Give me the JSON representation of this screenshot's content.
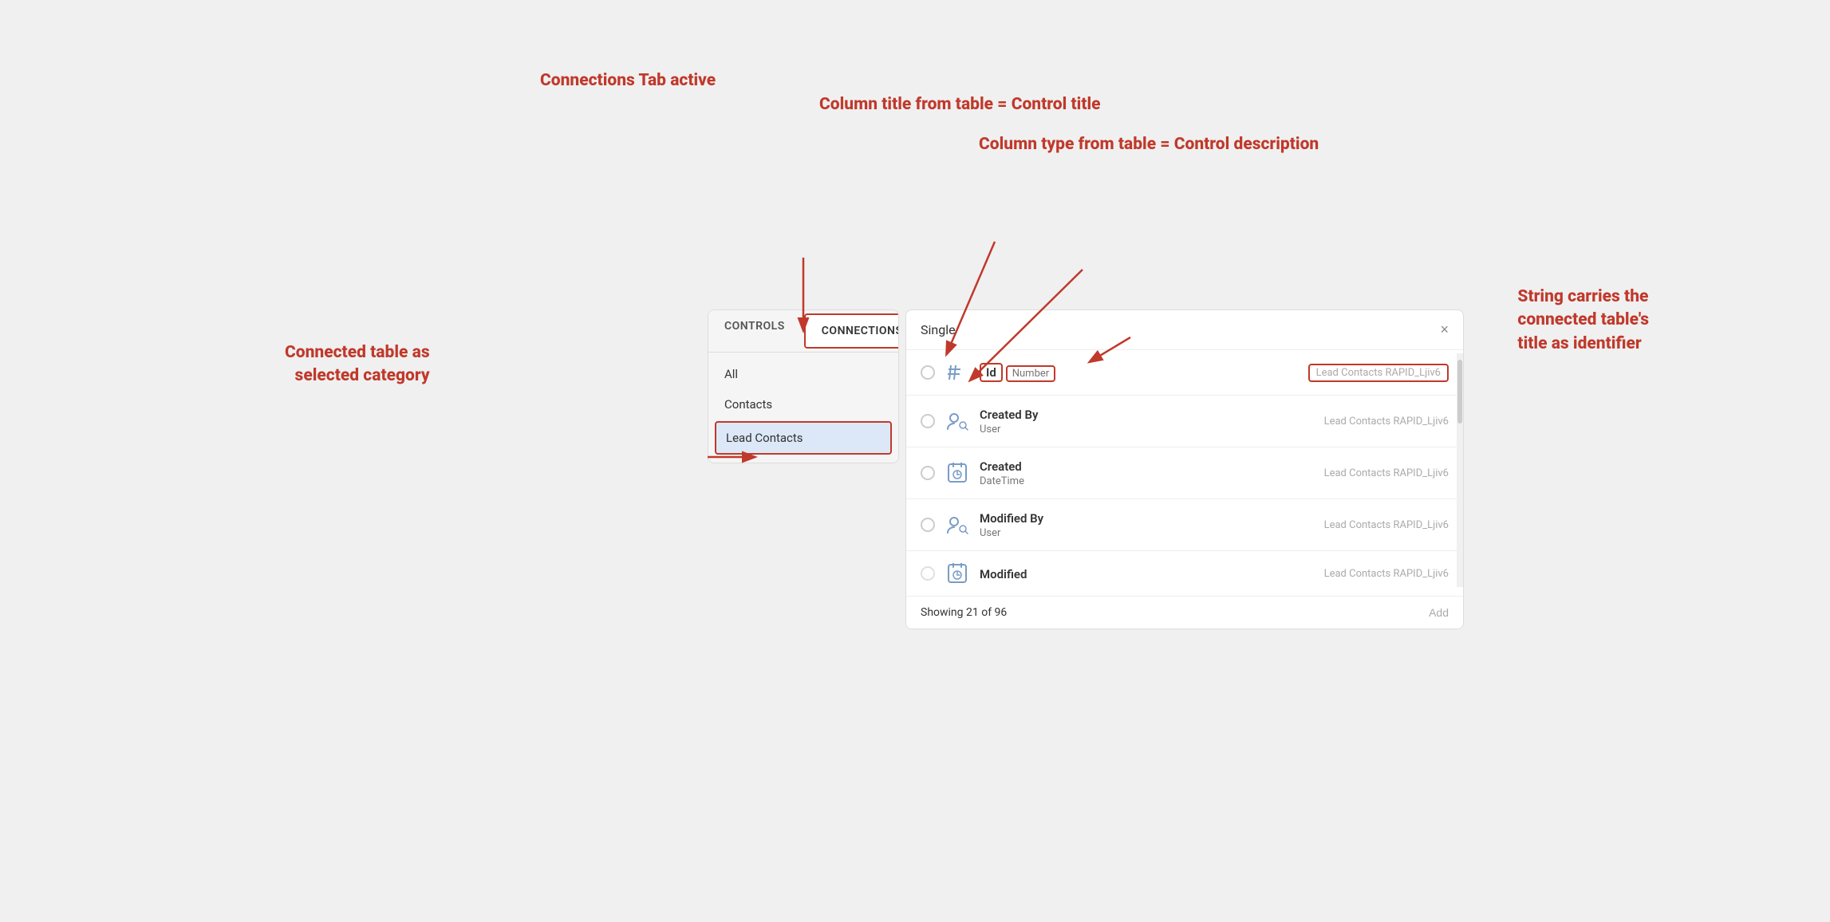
{
  "annotations": {
    "connections_tab_active": "Connections Tab active",
    "column_title": "Column title from table = Control title",
    "column_type": "Column type from table = Control description",
    "connected_table_label": "Connected table as\nselected category",
    "string_carries_label": "String carries the\nconnected table's\ntitle as identifier"
  },
  "left_panel": {
    "tab_controls": "CONTROLS",
    "tab_connections": "CONNECTIONS",
    "categories": [
      {
        "label": "All"
      },
      {
        "label": "Contacts"
      },
      {
        "label": "Lead Contacts",
        "selected": true
      }
    ]
  },
  "right_panel": {
    "title": "Single",
    "close_label": "×",
    "items": [
      {
        "name": "Id",
        "name_bordered": true,
        "type": "Number",
        "type_bordered": true,
        "source": "Lead Contacts  RAPID_Ljiv6",
        "source_bordered": true,
        "icon": "number"
      },
      {
        "name": "Created By",
        "type": "User",
        "source": "Lead Contacts  RAPID_Ljiv6",
        "icon": "user"
      },
      {
        "name": "Created",
        "type": "DateTime",
        "source": "Lead Contacts  RAPID_Ljiv6",
        "icon": "clock"
      },
      {
        "name": "Modified By",
        "type": "User",
        "source": "Lead Contacts  RAPID_Ljiv6",
        "icon": "user"
      },
      {
        "name": "Modified",
        "type": "",
        "source": "Lead Contacts  RAPID_Ljiv6",
        "icon": "clock",
        "partial": true
      }
    ],
    "footer_showing": "Showing 21 of 96",
    "footer_add": "Add"
  }
}
